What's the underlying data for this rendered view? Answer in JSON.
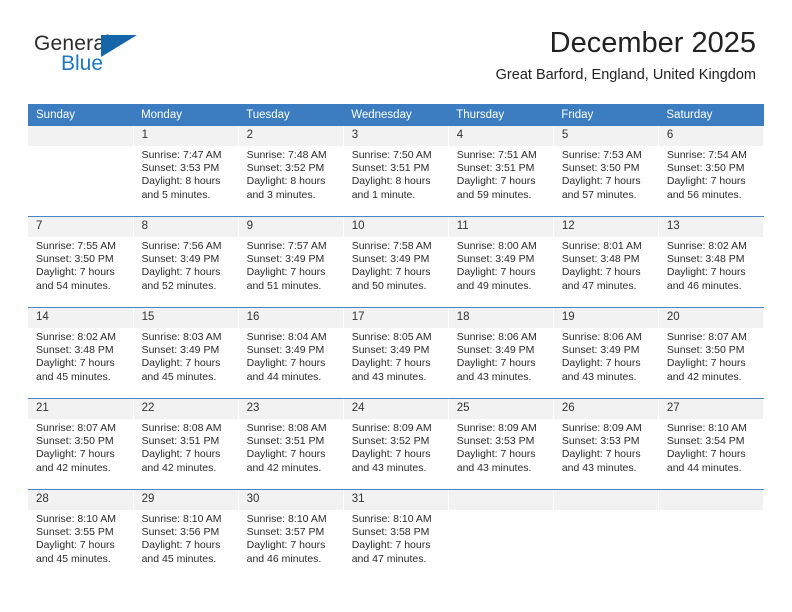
{
  "brand": {
    "name_part1": "General",
    "name_part2": "Blue",
    "flag_icon": "triangle-flag-icon"
  },
  "header": {
    "title": "December 2025",
    "subtitle": "Great Barford, England, United Kingdom"
  },
  "colors": {
    "header_row_bg": "#3b7dc0",
    "daynum_bg": "#f2f2f2",
    "brand_blue": "#1f77bc",
    "row_divider": "#4a86c4"
  },
  "weekday_headers": [
    "Sunday",
    "Monday",
    "Tuesday",
    "Wednesday",
    "Thursday",
    "Friday",
    "Saturday"
  ],
  "labels": {
    "sunrise_prefix": "Sunrise: ",
    "sunset_prefix": "Sunset: ",
    "daylight_prefix": "Daylight: "
  },
  "weeks": [
    [
      {
        "day": "",
        "sunrise": "",
        "sunset": "",
        "daylight_a": "",
        "daylight_b": "",
        "empty": true
      },
      {
        "day": "1",
        "sunrise": "Sunrise: 7:47 AM",
        "sunset": "Sunset: 3:53 PM",
        "daylight_a": "Daylight: 8 hours",
        "daylight_b": "and 5 minutes."
      },
      {
        "day": "2",
        "sunrise": "Sunrise: 7:48 AM",
        "sunset": "Sunset: 3:52 PM",
        "daylight_a": "Daylight: 8 hours",
        "daylight_b": "and 3 minutes."
      },
      {
        "day": "3",
        "sunrise": "Sunrise: 7:50 AM",
        "sunset": "Sunset: 3:51 PM",
        "daylight_a": "Daylight: 8 hours",
        "daylight_b": "and 1 minute."
      },
      {
        "day": "4",
        "sunrise": "Sunrise: 7:51 AM",
        "sunset": "Sunset: 3:51 PM",
        "daylight_a": "Daylight: 7 hours",
        "daylight_b": "and 59 minutes."
      },
      {
        "day": "5",
        "sunrise": "Sunrise: 7:53 AM",
        "sunset": "Sunset: 3:50 PM",
        "daylight_a": "Daylight: 7 hours",
        "daylight_b": "and 57 minutes."
      },
      {
        "day": "6",
        "sunrise": "Sunrise: 7:54 AM",
        "sunset": "Sunset: 3:50 PM",
        "daylight_a": "Daylight: 7 hours",
        "daylight_b": "and 56 minutes."
      }
    ],
    [
      {
        "day": "7",
        "sunrise": "Sunrise: 7:55 AM",
        "sunset": "Sunset: 3:50 PM",
        "daylight_a": "Daylight: 7 hours",
        "daylight_b": "and 54 minutes."
      },
      {
        "day": "8",
        "sunrise": "Sunrise: 7:56 AM",
        "sunset": "Sunset: 3:49 PM",
        "daylight_a": "Daylight: 7 hours",
        "daylight_b": "and 52 minutes."
      },
      {
        "day": "9",
        "sunrise": "Sunrise: 7:57 AM",
        "sunset": "Sunset: 3:49 PM",
        "daylight_a": "Daylight: 7 hours",
        "daylight_b": "and 51 minutes."
      },
      {
        "day": "10",
        "sunrise": "Sunrise: 7:58 AM",
        "sunset": "Sunset: 3:49 PM",
        "daylight_a": "Daylight: 7 hours",
        "daylight_b": "and 50 minutes."
      },
      {
        "day": "11",
        "sunrise": "Sunrise: 8:00 AM",
        "sunset": "Sunset: 3:49 PM",
        "daylight_a": "Daylight: 7 hours",
        "daylight_b": "and 49 minutes."
      },
      {
        "day": "12",
        "sunrise": "Sunrise: 8:01 AM",
        "sunset": "Sunset: 3:48 PM",
        "daylight_a": "Daylight: 7 hours",
        "daylight_b": "and 47 minutes."
      },
      {
        "day": "13",
        "sunrise": "Sunrise: 8:02 AM",
        "sunset": "Sunset: 3:48 PM",
        "daylight_a": "Daylight: 7 hours",
        "daylight_b": "and 46 minutes."
      }
    ],
    [
      {
        "day": "14",
        "sunrise": "Sunrise: 8:02 AM",
        "sunset": "Sunset: 3:48 PM",
        "daylight_a": "Daylight: 7 hours",
        "daylight_b": "and 45 minutes."
      },
      {
        "day": "15",
        "sunrise": "Sunrise: 8:03 AM",
        "sunset": "Sunset: 3:49 PM",
        "daylight_a": "Daylight: 7 hours",
        "daylight_b": "and 45 minutes."
      },
      {
        "day": "16",
        "sunrise": "Sunrise: 8:04 AM",
        "sunset": "Sunset: 3:49 PM",
        "daylight_a": "Daylight: 7 hours",
        "daylight_b": "and 44 minutes."
      },
      {
        "day": "17",
        "sunrise": "Sunrise: 8:05 AM",
        "sunset": "Sunset: 3:49 PM",
        "daylight_a": "Daylight: 7 hours",
        "daylight_b": "and 43 minutes."
      },
      {
        "day": "18",
        "sunrise": "Sunrise: 8:06 AM",
        "sunset": "Sunset: 3:49 PM",
        "daylight_a": "Daylight: 7 hours",
        "daylight_b": "and 43 minutes."
      },
      {
        "day": "19",
        "sunrise": "Sunrise: 8:06 AM",
        "sunset": "Sunset: 3:49 PM",
        "daylight_a": "Daylight: 7 hours",
        "daylight_b": "and 43 minutes."
      },
      {
        "day": "20",
        "sunrise": "Sunrise: 8:07 AM",
        "sunset": "Sunset: 3:50 PM",
        "daylight_a": "Daylight: 7 hours",
        "daylight_b": "and 42 minutes."
      }
    ],
    [
      {
        "day": "21",
        "sunrise": "Sunrise: 8:07 AM",
        "sunset": "Sunset: 3:50 PM",
        "daylight_a": "Daylight: 7 hours",
        "daylight_b": "and 42 minutes."
      },
      {
        "day": "22",
        "sunrise": "Sunrise: 8:08 AM",
        "sunset": "Sunset: 3:51 PM",
        "daylight_a": "Daylight: 7 hours",
        "daylight_b": "and 42 minutes."
      },
      {
        "day": "23",
        "sunrise": "Sunrise: 8:08 AM",
        "sunset": "Sunset: 3:51 PM",
        "daylight_a": "Daylight: 7 hours",
        "daylight_b": "and 42 minutes."
      },
      {
        "day": "24",
        "sunrise": "Sunrise: 8:09 AM",
        "sunset": "Sunset: 3:52 PM",
        "daylight_a": "Daylight: 7 hours",
        "daylight_b": "and 43 minutes."
      },
      {
        "day": "25",
        "sunrise": "Sunrise: 8:09 AM",
        "sunset": "Sunset: 3:53 PM",
        "daylight_a": "Daylight: 7 hours",
        "daylight_b": "and 43 minutes."
      },
      {
        "day": "26",
        "sunrise": "Sunrise: 8:09 AM",
        "sunset": "Sunset: 3:53 PM",
        "daylight_a": "Daylight: 7 hours",
        "daylight_b": "and 43 minutes."
      },
      {
        "day": "27",
        "sunrise": "Sunrise: 8:10 AM",
        "sunset": "Sunset: 3:54 PM",
        "daylight_a": "Daylight: 7 hours",
        "daylight_b": "and 44 minutes."
      }
    ],
    [
      {
        "day": "28",
        "sunrise": "Sunrise: 8:10 AM",
        "sunset": "Sunset: 3:55 PM",
        "daylight_a": "Daylight: 7 hours",
        "daylight_b": "and 45 minutes."
      },
      {
        "day": "29",
        "sunrise": "Sunrise: 8:10 AM",
        "sunset": "Sunset: 3:56 PM",
        "daylight_a": "Daylight: 7 hours",
        "daylight_b": "and 45 minutes."
      },
      {
        "day": "30",
        "sunrise": "Sunrise: 8:10 AM",
        "sunset": "Sunset: 3:57 PM",
        "daylight_a": "Daylight: 7 hours",
        "daylight_b": "and 46 minutes."
      },
      {
        "day": "31",
        "sunrise": "Sunrise: 8:10 AM",
        "sunset": "Sunset: 3:58 PM",
        "daylight_a": "Daylight: 7 hours",
        "daylight_b": "and 47 minutes."
      },
      {
        "day": "",
        "sunrise": "",
        "sunset": "",
        "daylight_a": "",
        "daylight_b": "",
        "empty": true
      },
      {
        "day": "",
        "sunrise": "",
        "sunset": "",
        "daylight_a": "",
        "daylight_b": "",
        "empty": true
      },
      {
        "day": "",
        "sunrise": "",
        "sunset": "",
        "daylight_a": "",
        "daylight_b": "",
        "empty": true
      }
    ]
  ]
}
